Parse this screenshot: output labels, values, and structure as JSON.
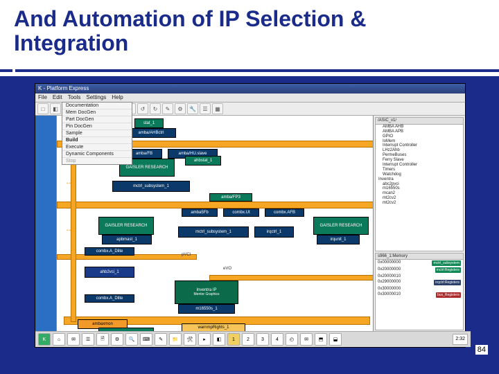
{
  "slide": {
    "title": "And Automation of IP Selection & Integration",
    "pageNumber": "84"
  },
  "app": {
    "title": "K - Platform Express"
  },
  "menu": [
    "File",
    "Edit",
    "Tools",
    "Settings",
    "Help"
  ],
  "dropdown": [
    "Documentation",
    "Mem DocGen",
    "Part DocGen",
    "Pin DocGen",
    "Sample",
    "Build",
    "Execute",
    "Dynamic Components",
    "Stop"
  ],
  "toolbar_icons": [
    "□",
    "◧",
    "▣",
    "⟳",
    "⎙",
    "⌕",
    "✂",
    "⧉",
    "↺",
    "↻",
    "✎",
    "⚙",
    "🔧",
    "☰",
    "▦"
  ],
  "tree": {
    "title": "/ASIC_v1/",
    "items": [
      "AMBA AHB",
      "AMBA APB",
      "GPIO",
      "IoMem",
      "Interrupt Controller",
      "LHz2Ahb",
      "PermeBuses",
      "Ferry Slave",
      "Interrupt Controller",
      "Timers",
      "Watchdog",
      "Inventra",
      "abc2pvci",
      "m16550s",
      "mcan2",
      "mt2cv2",
      "mt2cv2"
    ]
  },
  "panel": {
    "title": "s966_1:Memory",
    "rows": [
      {
        "addr": "0x00000000",
        "chip": "mctrl_subsystem",
        "color": "#118855"
      },
      {
        "addr": "0x20000000",
        "chip": "mctrl:Registers",
        "color": "#118855"
      },
      {
        "addr": "0x20000010",
        "chip": "",
        "color": ""
      },
      {
        "addr": "0x29000000",
        "chip": "irqctrl:Registers",
        "color": "#2a3f6a"
      },
      {
        "addr": "0x30000000",
        "chip": "",
        "color": ""
      },
      {
        "addr": "0x30000010",
        "chip": "bus_Registers",
        "color": "#aa2b2b"
      }
    ]
  },
  "blocks": {
    "stat1": "stat_1",
    "ambaAHB": "amba/AHBctrl",
    "ambaFB": "amba/FB",
    "ambaHU": "amba/HU.slave",
    "gaisler": "GAISLER\\nRESEARCH",
    "ahbstat": "ahbstat_1",
    "mctrl_sub": "mctrl_subsystem_1",
    "ambaFP3": "amba/FP3",
    "amba5": "amba5Fb",
    "combxUt": "combx.Ut",
    "combxAFB": "combx.AFB",
    "apbmast": "apbmast_1",
    "mctrl_sub2": "mctrl_subsystem_1",
    "irqctrl": "irqctrl_1",
    "irqunit": "irqunit_1",
    "combxLite": "combx.A_Dlite",
    "pvci": "pVCI",
    "evo": "eVO",
    "ahb2vci": "ahb2vci_1",
    "inventra": "Inventra IP",
    "mentor": "Mentor\\nGraphics",
    "combxDlite": "combx.A_Dlite",
    "m16550": "m16550s_1",
    "ambaxmon": "ambaxmon",
    "warnmpRights": "warnmpRights_1"
  },
  "taskbar": {
    "icons": [
      "K",
      "⌂",
      "✉",
      "☰",
      "🗎",
      "⚙",
      "🔍",
      "⌨",
      "✎",
      "📁",
      "🛠",
      "▸",
      "◧",
      "1",
      "2",
      "3",
      "4",
      "◴",
      "✉",
      "⬒",
      "⬓"
    ],
    "time": "2:32"
  }
}
